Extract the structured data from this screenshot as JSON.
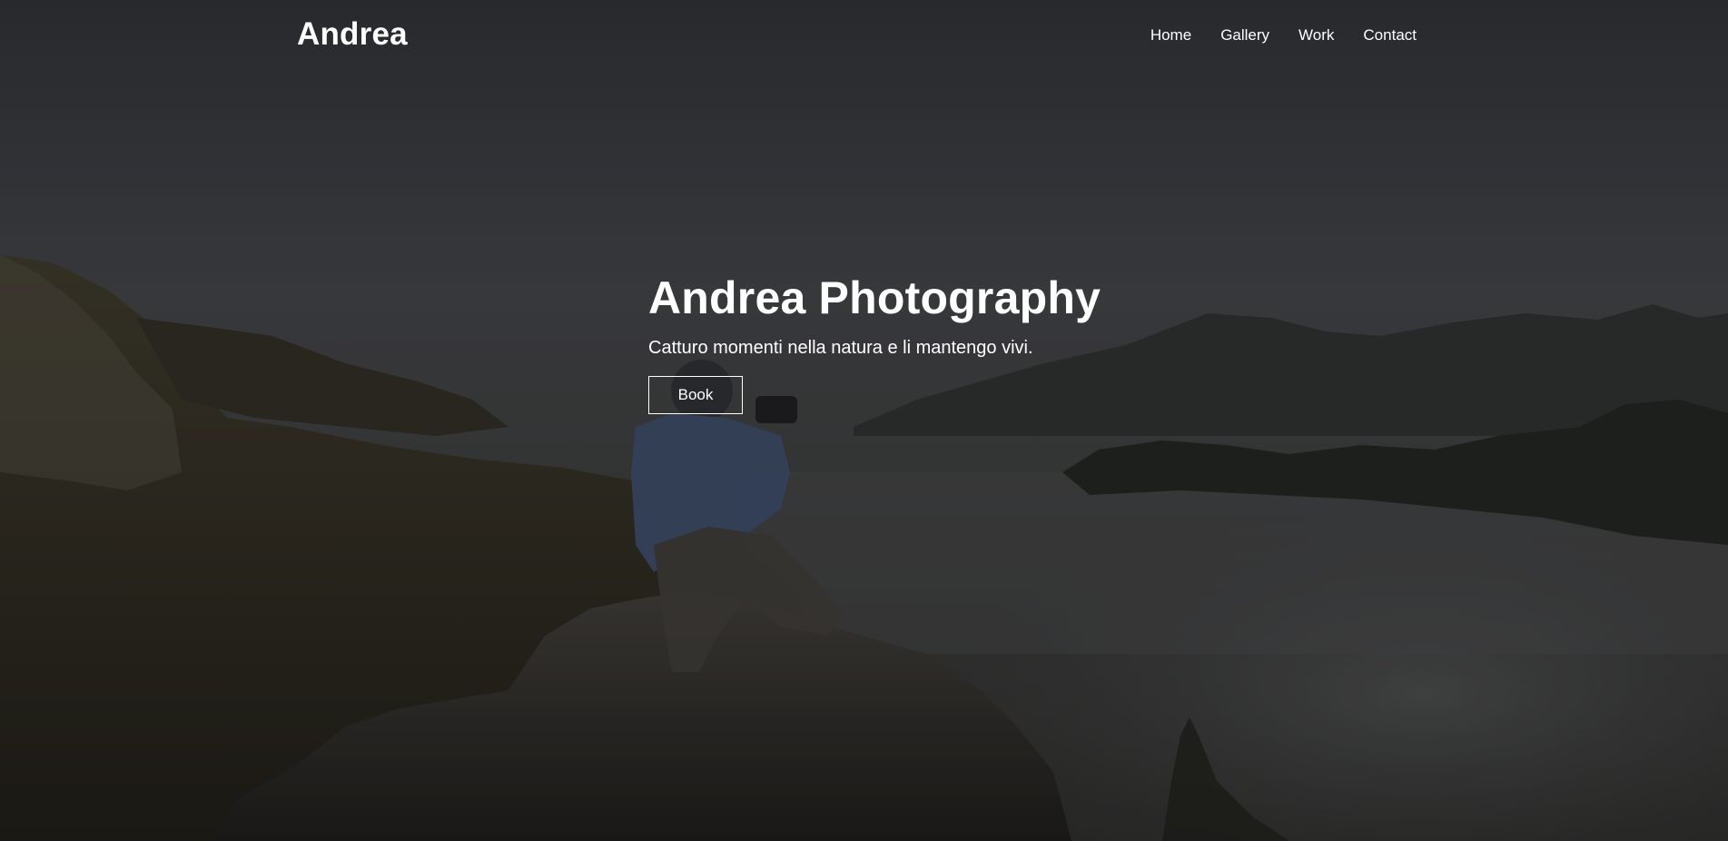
{
  "brand": {
    "name": "Andrea"
  },
  "nav": {
    "items": [
      {
        "label": "Home"
      },
      {
        "label": "Gallery"
      },
      {
        "label": "Work"
      },
      {
        "label": "Contact"
      }
    ]
  },
  "hero": {
    "title": "Andrea Photography",
    "subtitle": "Catturo momenti nella natura e li mantengo vivi.",
    "button_label": "Book",
    "background_image": "photographer-on-mountain-above-clouds"
  },
  "colors": {
    "text": "#ffffff",
    "overlay": "#1a1b1d"
  }
}
